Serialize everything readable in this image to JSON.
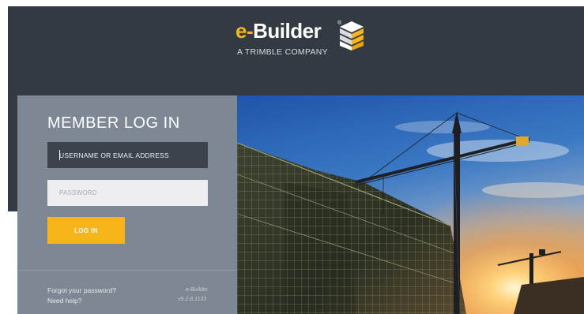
{
  "colors": {
    "accent": "#f7b519",
    "header_bg": "#343a42",
    "panel_bg": "#7e8894"
  },
  "logo": {
    "brand_prefix": "e-",
    "brand_name": "Builder",
    "registered": "®",
    "tagline": "A TRIMBLE COMPANY",
    "icon": "stacked-cube-icon"
  },
  "login": {
    "title": "MEMBER LOG IN",
    "username_placeholder": "USERNAME OR EMAIL ADDRESS",
    "password_placeholder": "PASSWORD",
    "submit_label": "LOG IN",
    "forgot_label": "Forgot your password?",
    "help_label": "Need help?",
    "product_name": "e-Builder",
    "version": "v9.2.8.1133"
  },
  "hero": {
    "image": "construction-site-with-cranes-at-sunset"
  }
}
